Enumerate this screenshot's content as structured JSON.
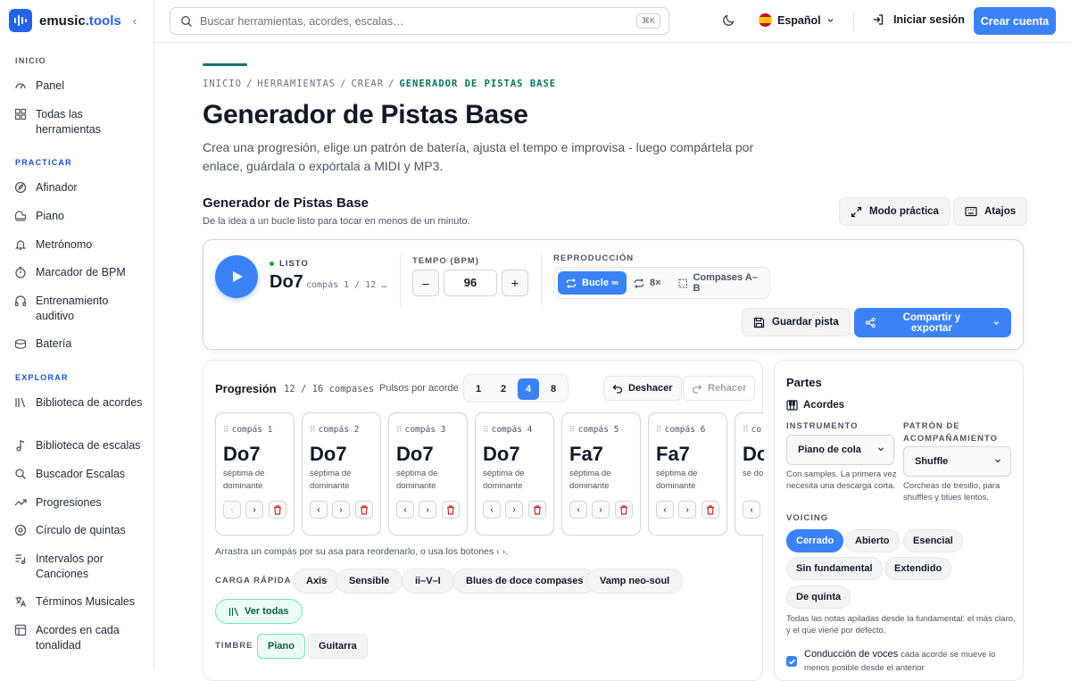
{
  "app": {
    "name": "emusic",
    "tld": ".tools"
  },
  "sidebar": {
    "sections": [
      {
        "title": "INICIO",
        "items": [
          {
            "label": "Panel"
          },
          {
            "label": "Todas las herramientas"
          }
        ]
      },
      {
        "title": "PRACTICAR",
        "items": [
          {
            "label": "Afinador"
          },
          {
            "label": "Piano"
          },
          {
            "label": "Metrónomo"
          },
          {
            "label": "Marcador de BPM"
          },
          {
            "label": "Entrenamiento auditivo"
          },
          {
            "label": "Batería"
          }
        ]
      },
      {
        "title": "EXPLORAR",
        "items": [
          {
            "label": "Biblioteca de acordes"
          },
          {
            "label": "Biblioteca de escalas"
          },
          {
            "label": "Buscador Escalas"
          },
          {
            "label": "Progresiones"
          },
          {
            "label": "Círculo de quintas"
          },
          {
            "label": "Intervalos por Canciones"
          },
          {
            "label": "Términos Musicales"
          },
          {
            "label": "Acordes en cada tonalidad"
          }
        ]
      }
    ]
  },
  "topbar": {
    "search_placeholder": "Buscar herramientas, acordes, escalas…",
    "search_shortcut": "⌘K",
    "language": "Español",
    "login": "Iniciar sesión",
    "signup": "Crear cuenta"
  },
  "breadcrumb": [
    "INICIO",
    "HERRAMIENTAS",
    "CREAR",
    "GENERADOR DE PISTAS BASE"
  ],
  "page": {
    "title": "Generador de Pistas Base",
    "description": "Crea una progresión, elige un patrón de batería, ajusta el tempo e improvisa - luego compártela por enlace, guárdala o expórtala a MIDI y MP3.",
    "subtitle": "Generador de Pistas Base",
    "subdescription": "De la idea a un bucle listo para tocar en menos de un minuto.",
    "practice_mode": "Modo práctica",
    "shortcuts": "Atajos"
  },
  "player": {
    "status": "LISTO",
    "current_chord": "Do7",
    "current_bar": "compás 1 / 12 …",
    "tempo_label": "TEMPO (BPM)",
    "bpm": "96",
    "minus": "–",
    "plus": "+",
    "playback_label": "REPRODUCCIÓN",
    "loop": "Bucle ∞",
    "repeat": "8×",
    "ab": "Compases A–B",
    "save": "Guardar pista",
    "share": "Compartir y exportar"
  },
  "progression": {
    "title": "Progresión",
    "count": "12 / 16 compases",
    "beats_label": "Pulsos por acorde",
    "beats_options": [
      "1",
      "2",
      "4",
      "8"
    ],
    "beats_selected": "4",
    "undo": "Deshacer",
    "redo": "Rehacer",
    "bars": [
      {
        "label": "compás 1",
        "chord": "Do7",
        "quality": "séptima de dominante"
      },
      {
        "label": "compás 2",
        "chord": "Do7",
        "quality": "séptima de dominante"
      },
      {
        "label": "compás 3",
        "chord": "Do7",
        "quality": "séptima de dominante"
      },
      {
        "label": "compás 4",
        "chord": "Do7",
        "quality": "séptima de dominante"
      },
      {
        "label": "compás 5",
        "chord": "Fa7",
        "quality": "séptima de dominante"
      },
      {
        "label": "compás 6",
        "chord": "Fa7",
        "quality": "séptima de dominante"
      },
      {
        "label": "co",
        "chord": "Do",
        "quality": "sé do"
      }
    ],
    "hint": "Arrastra un compás por su asa para reordenarlo, o usa los botones ‹ ›.",
    "quick_label": "CARGA RÁPIDA",
    "quick_loads": [
      "Axis",
      "Sensible",
      "ii–V–I",
      "Blues de doce compases",
      "Vamp neo-soul"
    ],
    "see_all": "Ver todas",
    "timbre_label": "TIMBRE",
    "timbres": [
      "Piano",
      "Guitarra"
    ]
  },
  "parts": {
    "title": "Partes",
    "section": "Acordes",
    "instrument_label": "INSTRUMENTO",
    "instrument": "Piano de cola",
    "instrument_note": "Con samples. La primera vez necesita una descarga corta.",
    "pattern_label": "PATRÓN DE ACOMPAÑAMIENTO",
    "pattern": "Shuffle",
    "pattern_note": "Corcheas de tresillo, para shuffles y blues lentos.",
    "voicing_label": "VOICING",
    "voicings": [
      "Cerrado",
      "Abierto",
      "Esencial",
      "Sin fundamental",
      "Extendido",
      "De quinta"
    ],
    "voicing_selected": "Cerrado",
    "voicing_note": "Todas las notas apiladas desde la fundamental: el más claro, y el que viene por defecto.",
    "voice_leading": "Conducción de voces",
    "voice_leading_note": "cada acorde se mueve lo menos posible desde el anterior"
  },
  "colors": {
    "accent": "#3b82f6",
    "brand": "#2563eb",
    "teal": "#047857",
    "danger": "#dc2626"
  }
}
